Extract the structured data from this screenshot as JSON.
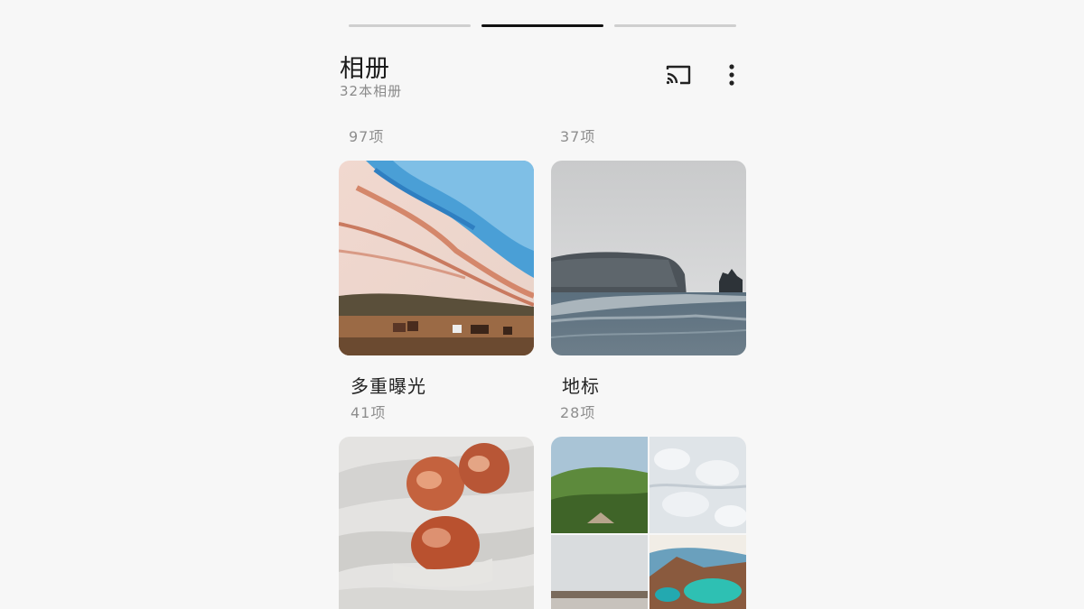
{
  "header": {
    "title": "相册",
    "subtitle": "32本相册"
  },
  "top_row_counts": [
    "97项",
    "37项"
  ],
  "albums": [
    {
      "name": "多重曝光",
      "count": "41项"
    },
    {
      "name": "地标",
      "count": "28项"
    }
  ],
  "icons": {
    "cast": "cast-icon",
    "more": "more-vertical-icon"
  },
  "colors": {
    "background": "#f7f7f7",
    "active_tab": "#111111",
    "inactive_tab": "#cfcfcf"
  }
}
